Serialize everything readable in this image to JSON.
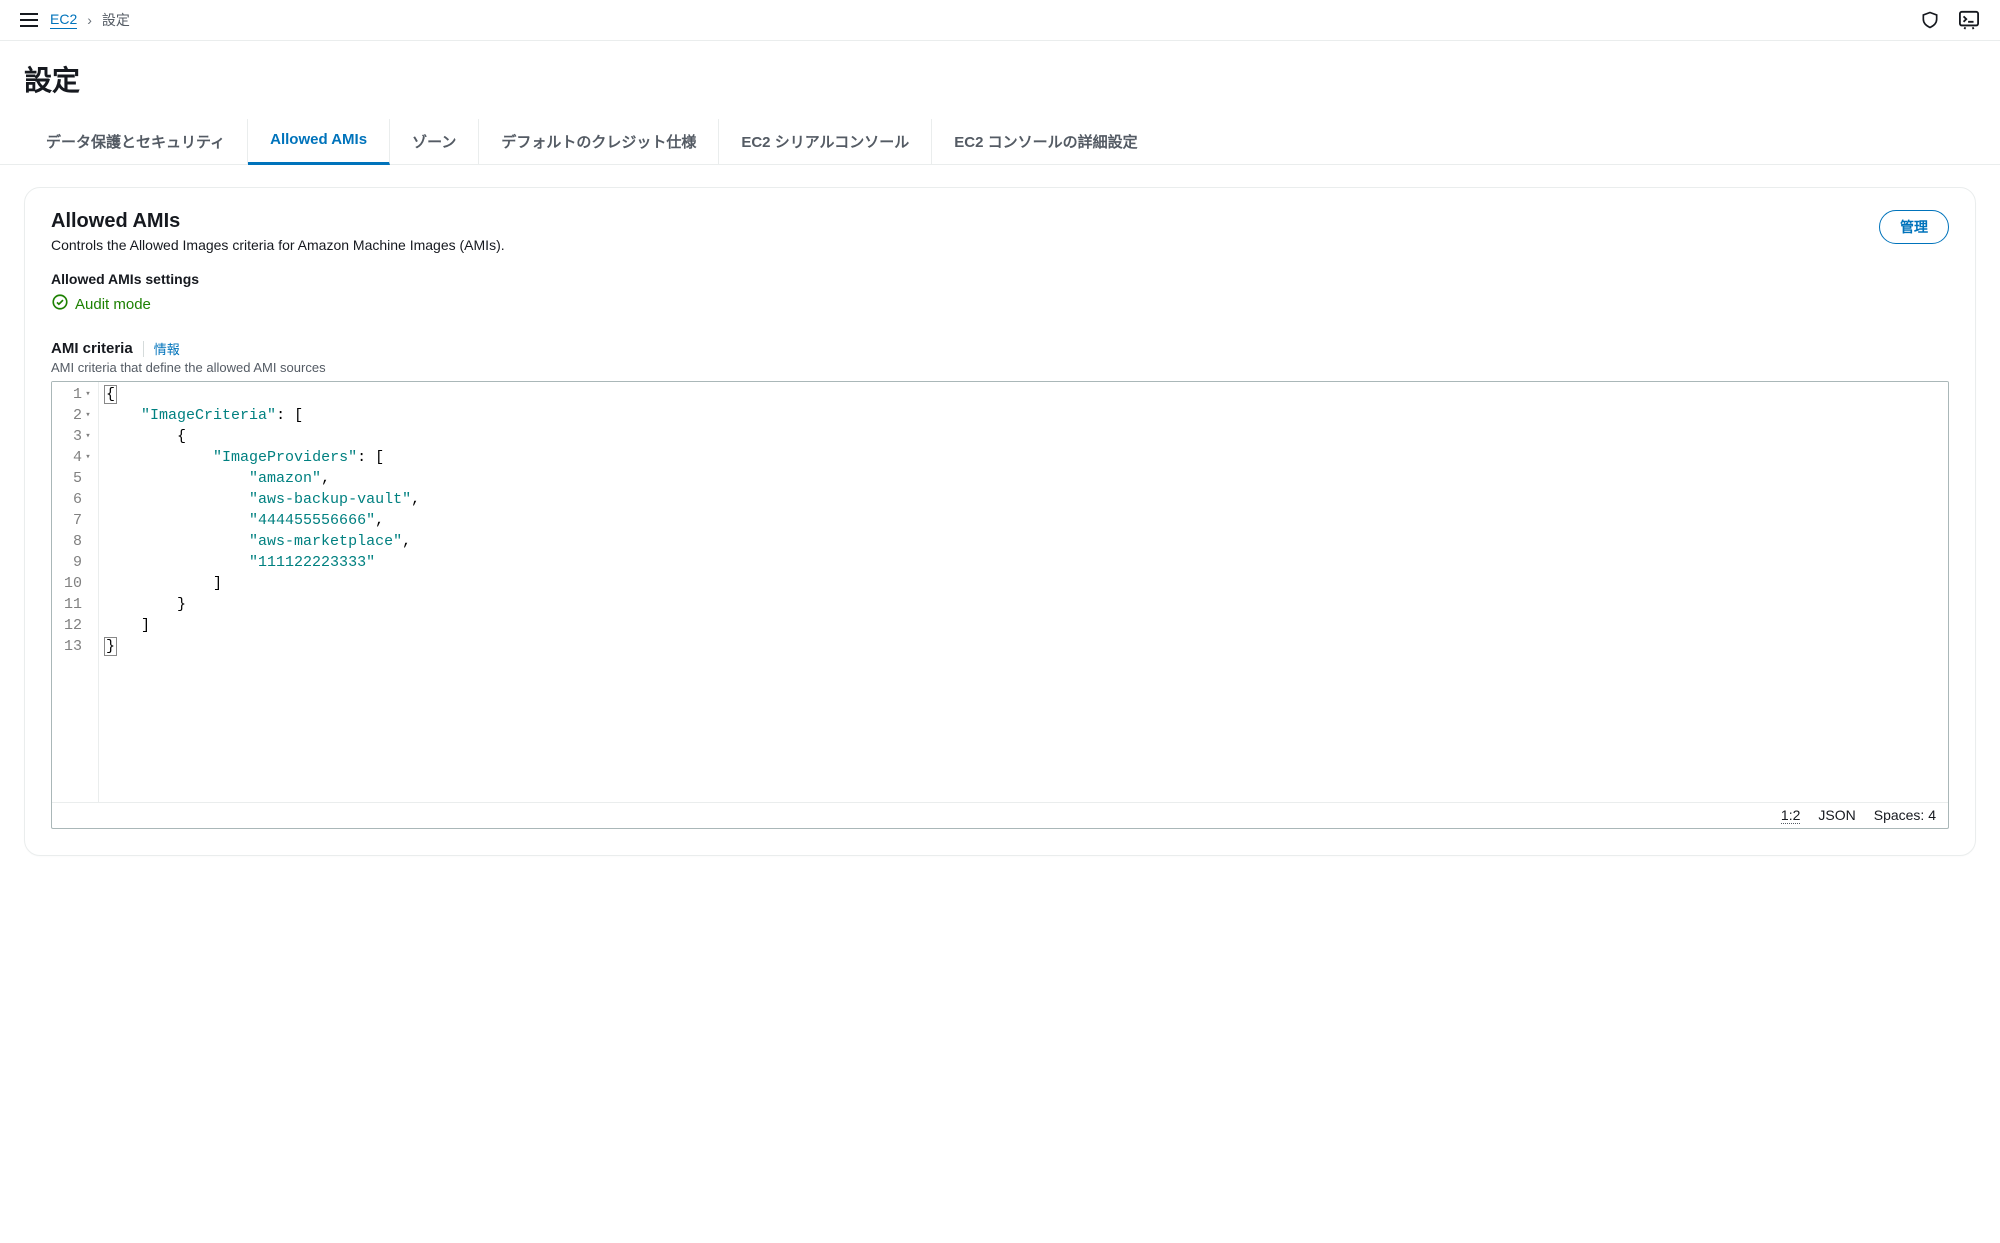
{
  "breadcrumb": {
    "service": "EC2",
    "current": "設定"
  },
  "page": {
    "title": "設定"
  },
  "tabs": {
    "dataProtection": "データ保護とセキュリティ",
    "allowedAmis": "Allowed AMIs",
    "zones": "ゾーン",
    "defaultCredit": "デフォルトのクレジット仕様",
    "serialConsole": "EC2 シリアルコンソール",
    "consoleSettings": "EC2 コンソールの詳細設定"
  },
  "panel": {
    "title": "Allowed AMIs",
    "description": "Controls the Allowed Images criteria for Amazon Machine Images (AMIs).",
    "manageLabel": "管理",
    "settingsLabel": "Allowed AMIs settings",
    "statusText": "Audit mode",
    "criteriaTitle": "AMI criteria",
    "infoLabel": "情報",
    "criteriaDesc": "AMI criteria that define the allowed AMI sources"
  },
  "editor": {
    "lineNumbers": [
      "1",
      "2",
      "3",
      "4",
      "5",
      "6",
      "7",
      "8",
      "9",
      "10",
      "11",
      "12",
      "13"
    ],
    "foldable": [
      true,
      true,
      true,
      true,
      false,
      false,
      false,
      false,
      false,
      false,
      false,
      false,
      false
    ],
    "tokens": {
      "open_brace": "{",
      "close_brace": "}",
      "open_bracket": "[",
      "close_bracket": "]",
      "key_imageCriteria": "\"ImageCriteria\"",
      "key_imageProviders": "\"ImageProviders\"",
      "val_amazon": "\"amazon\"",
      "val_backup": "\"aws-backup-vault\"",
      "val_acct1": "\"444455556666\"",
      "val_marketplace": "\"aws-marketplace\"",
      "val_acct2": "\"111122223333\"",
      "colon_space": ": ",
      "comma": ","
    },
    "status": {
      "position": "1:2",
      "mode": "JSON",
      "spaces": "Spaces: 4"
    }
  }
}
